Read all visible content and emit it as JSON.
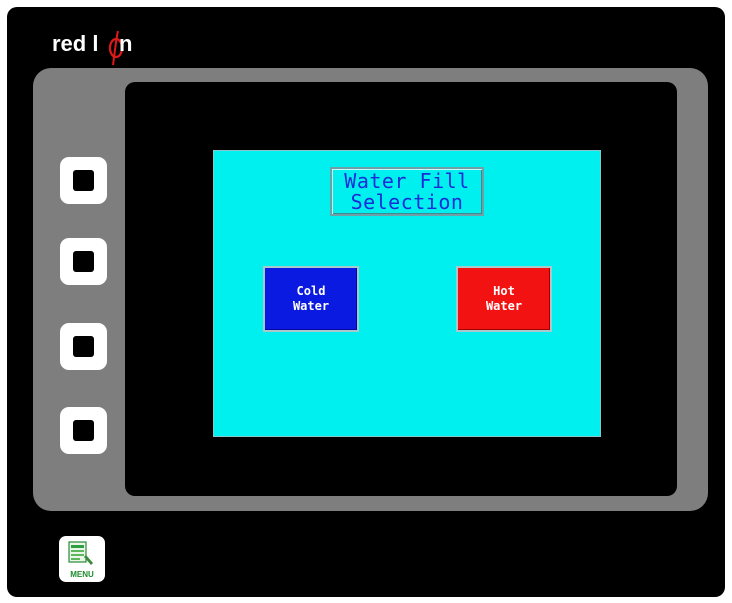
{
  "device": {
    "brand_part1": "red l",
    "brand_part2": "n",
    "menu_key_label": "MENU"
  },
  "screen": {
    "title_line1": "Water Fill",
    "title_line2": "Selection",
    "buttons": [
      {
        "line1": "Cold",
        "line2": "Water",
        "color": "#0a1ae0"
      },
      {
        "line1": "Hot",
        "line2": "Water",
        "color": "#f31212"
      }
    ],
    "background_color": "#00f0f0",
    "title_color": "#1a2cd6"
  },
  "softkeys": [
    "softkey",
    "softkey",
    "softkey",
    "softkey"
  ],
  "icons": {
    "brand_logo": "red-lion-logo",
    "menu": "menu-list-icon"
  }
}
